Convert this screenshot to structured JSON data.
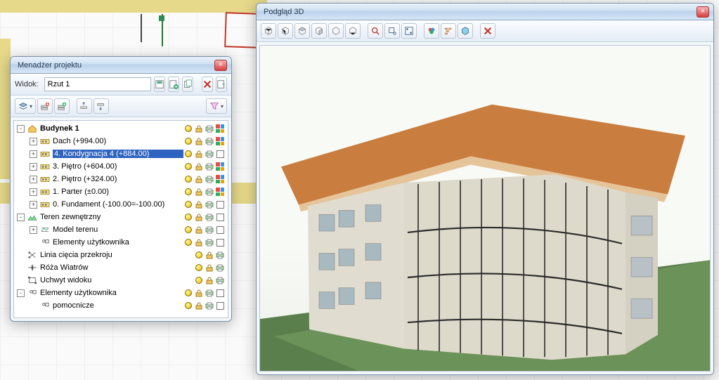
{
  "panels": {
    "preview3d": {
      "title": "Podgląd 3D"
    },
    "projectmgr": {
      "title": "Menadżer projektu"
    }
  },
  "view": {
    "label": "Widok:",
    "value": "Rzut 1"
  },
  "tree": [
    {
      "id": "budynek",
      "indent": 0,
      "exp": "-",
      "icon": "house",
      "label": "Budynek 1",
      "bold": true,
      "sel": false,
      "bulb": true,
      "lock": true,
      "print": true,
      "extra": "quad"
    },
    {
      "id": "dach",
      "indent": 1,
      "exp": "+",
      "icon": "level",
      "label": "Dach (+994.00)",
      "bold": false,
      "sel": false,
      "bulb": true,
      "lock": true,
      "print": true,
      "extra": "quad"
    },
    {
      "id": "k4",
      "indent": 1,
      "exp": "+",
      "icon": "level",
      "label": "4. Kondygnacja 4 (+884.00)",
      "bold": false,
      "sel": true,
      "bulb": true,
      "lock": true,
      "print": true,
      "extra": "box"
    },
    {
      "id": "p3",
      "indent": 1,
      "exp": "+",
      "icon": "level",
      "label": "3. Piętro (+604.00)",
      "bold": false,
      "sel": false,
      "bulb": true,
      "lock": true,
      "print": true,
      "extra": "quad"
    },
    {
      "id": "p2",
      "indent": 1,
      "exp": "+",
      "icon": "level",
      "label": "2. Piętro (+324.00)",
      "bold": false,
      "sel": false,
      "bulb": true,
      "lock": true,
      "print": true,
      "extra": "quad"
    },
    {
      "id": "p1",
      "indent": 1,
      "exp": "+",
      "icon": "level",
      "label": "1. Parter (±0.00)",
      "bold": false,
      "sel": false,
      "bulb": true,
      "lock": true,
      "print": true,
      "extra": "quad"
    },
    {
      "id": "fund",
      "indent": 1,
      "exp": "+",
      "icon": "level",
      "label": "0. Fundament (-100.00=-100.00)",
      "bold": false,
      "sel": false,
      "bulb": true,
      "lock": true,
      "print": true,
      "extra": "box"
    },
    {
      "id": "teren",
      "indent": 0,
      "exp": "-",
      "icon": "terrain",
      "label": "Teren zewnętrzny",
      "bold": false,
      "sel": false,
      "bulb": true,
      "lock": true,
      "print": true,
      "extra": "box"
    },
    {
      "id": "model",
      "indent": 1,
      "exp": "+",
      "icon": "mesh",
      "label": "Model terenu",
      "bold": false,
      "sel": false,
      "bulb": true,
      "lock": true,
      "print": true,
      "extra": "box"
    },
    {
      "id": "elem1",
      "indent": 1,
      "exp": " ",
      "icon": "user",
      "label": "Elementy użytkownika",
      "bold": false,
      "sel": false,
      "bulb": true,
      "lock": true,
      "print": true,
      "extra": "box"
    },
    {
      "id": "linia",
      "indent": 0,
      "exp": " ",
      "icon": "cut",
      "label": "Linia cięcia przekroju",
      "bold": false,
      "sel": false,
      "bulb": true,
      "lock": true,
      "print": true,
      "extra": null
    },
    {
      "id": "roza",
      "indent": 0,
      "exp": " ",
      "icon": "compass",
      "label": "Róża Wiatrów",
      "bold": false,
      "sel": false,
      "bulb": true,
      "lock": true,
      "print": true,
      "extra": null
    },
    {
      "id": "uchwyt",
      "indent": 0,
      "exp": " ",
      "icon": "handle",
      "label": "Uchwyt widoku",
      "bold": false,
      "sel": false,
      "bulb": true,
      "lock": true,
      "print": true,
      "extra": null
    },
    {
      "id": "elem2",
      "indent": 0,
      "exp": "-",
      "icon": "user",
      "label": "Elementy użytkownika",
      "bold": false,
      "sel": false,
      "bulb": true,
      "lock": true,
      "print": true,
      "extra": "box"
    },
    {
      "id": "pomoc",
      "indent": 1,
      "exp": " ",
      "icon": "user",
      "label": "pomocnicze",
      "bold": false,
      "sel": false,
      "bulb": true,
      "lock": true,
      "print": true,
      "extra": "box"
    }
  ],
  "toolbar3d": {
    "items": [
      "cube-v1",
      "cube-v2",
      "cube-v3",
      "cube-v4",
      "cube-v5",
      "cube-v6",
      "sep",
      "zoom",
      "zoom-all",
      "extents",
      "sep",
      "color",
      "wall",
      "box",
      "sep",
      "close-red"
    ]
  },
  "toolbarPMtop": {
    "items": [
      "page-add",
      "page-green",
      "page-dup",
      "sep",
      "delete-red",
      "export"
    ]
  },
  "toolbarPMsecond": {
    "items": [
      "layers",
      "add-level",
      "add-level-green",
      "sep",
      "move-up",
      "move-down"
    ],
    "right": [
      "filter"
    ]
  }
}
